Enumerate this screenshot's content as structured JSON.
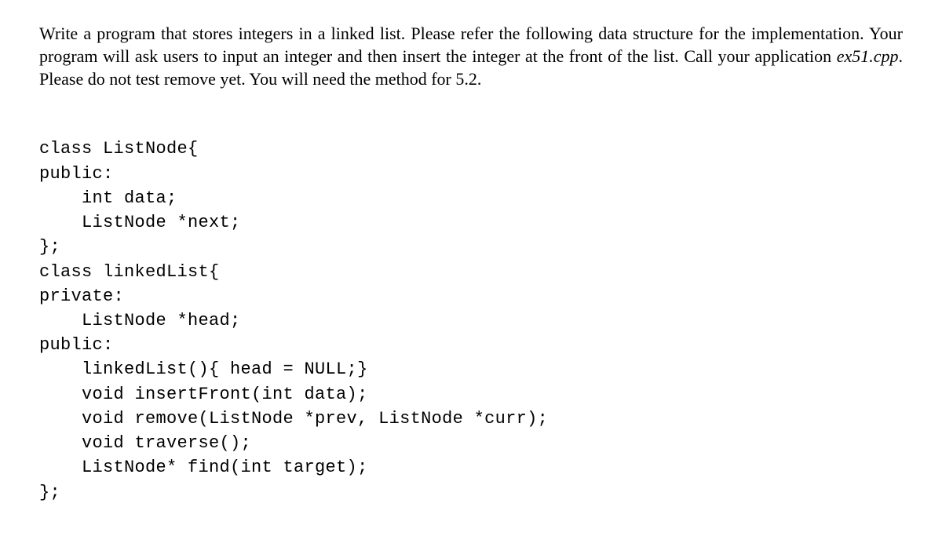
{
  "instruction": {
    "part1": "Write a program that stores integers in a linked list. Please refer the following data structure for the implementation. Your program will ask users to input an integer and then insert the integer at the front of the list. Call your application ",
    "filename": "ex51.cpp",
    "part2": ". Please do not test remove yet. You will need the method for 5.2."
  },
  "code": {
    "line1": "class ListNode{",
    "line2": "public:",
    "line3": "    int data;",
    "line4": "    ListNode *next;",
    "line5": "};",
    "line6": "class linkedList{",
    "line7": "private:",
    "line8": "    ListNode *head;",
    "line9": "public:",
    "line10": "    linkedList(){ head = NULL;}",
    "line11": "    void insertFront(int data);",
    "line12": "    void remove(ListNode *prev, ListNode *curr);",
    "line13": "    void traverse();",
    "line14": "    ListNode* find(int target);",
    "line15": "};"
  }
}
